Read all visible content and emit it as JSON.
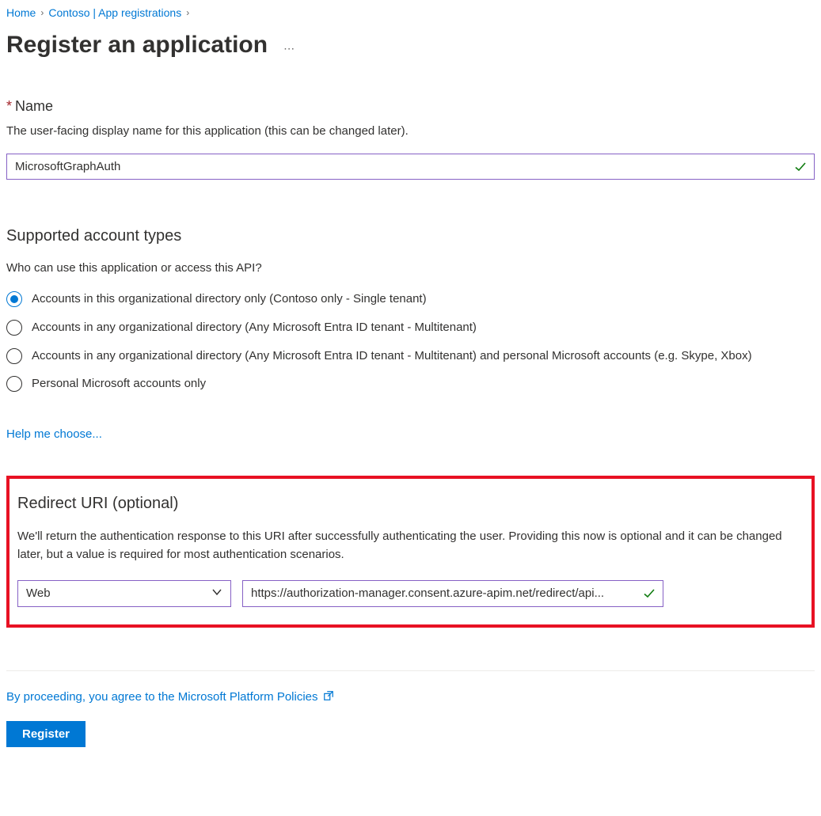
{
  "breadcrumb": {
    "home": "Home",
    "tenant": "Contoso | App registrations"
  },
  "page_title": "Register an application",
  "name_section": {
    "label": "Name",
    "help": "The user-facing display name for this application (this can be changed later).",
    "value": "MicrosoftGraphAuth"
  },
  "account_types": {
    "heading": "Supported account types",
    "question": "Who can use this application or access this API?",
    "options": [
      "Accounts in this organizational directory only (Contoso only - Single tenant)",
      "Accounts in any organizational directory (Any Microsoft Entra ID tenant - Multitenant)",
      "Accounts in any organizational directory (Any Microsoft Entra ID tenant - Multitenant) and personal Microsoft accounts (e.g. Skype, Xbox)",
      "Personal Microsoft accounts only"
    ],
    "selected_index": 0,
    "help_link": "Help me choose..."
  },
  "redirect": {
    "heading": "Redirect URI (optional)",
    "description": "We'll return the authentication response to this URI after successfully authenticating the user. Providing this now is optional and it can be changed later, but a value is required for most authentication scenarios.",
    "platform": "Web",
    "uri": "https://authorization-manager.consent.azure-apim.net/redirect/api..."
  },
  "footer": {
    "policy_text": "By proceeding, you agree to the Microsoft Platform Policies",
    "register_label": "Register"
  }
}
